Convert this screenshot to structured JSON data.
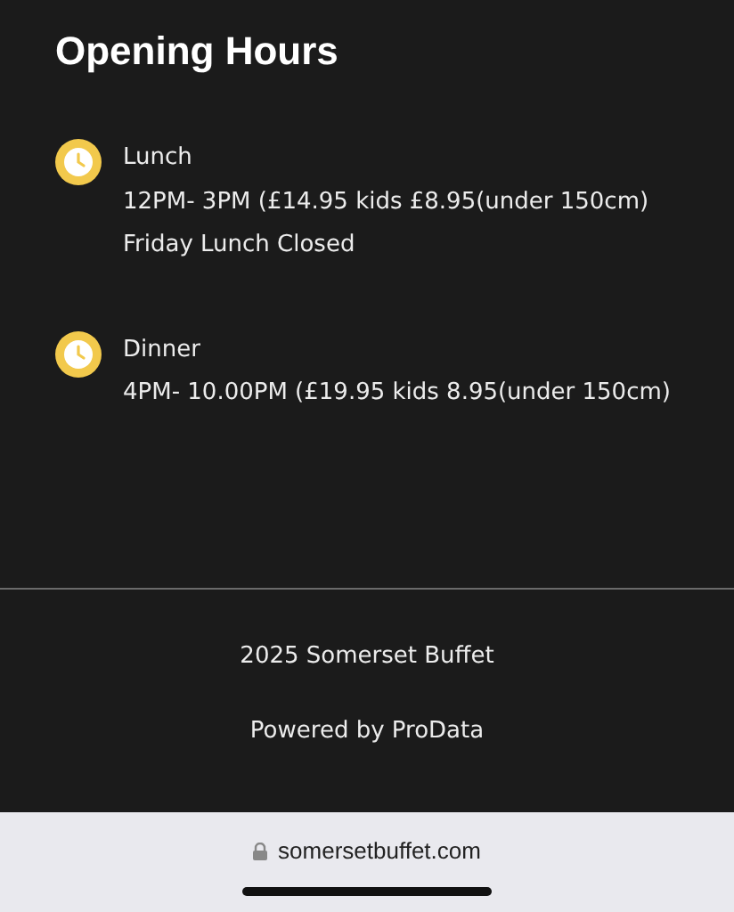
{
  "section": {
    "title": "Opening Hours"
  },
  "hours": [
    {
      "name": "Lunch",
      "lines": [
        "12PM- 3PM (£14.95 kids £8.95(under 150cm)",
        "Friday Lunch Closed"
      ]
    },
    {
      "name": "Dinner",
      "lines": [
        "4PM- 10.00PM (£19.95 kids 8.95(under 150cm)"
      ]
    }
  ],
  "footer": {
    "copyright": "2025 Somerset Buffet",
    "powered_by": "Powered by ProData"
  },
  "browser_bar": {
    "url": "somersetbuffet.com"
  }
}
